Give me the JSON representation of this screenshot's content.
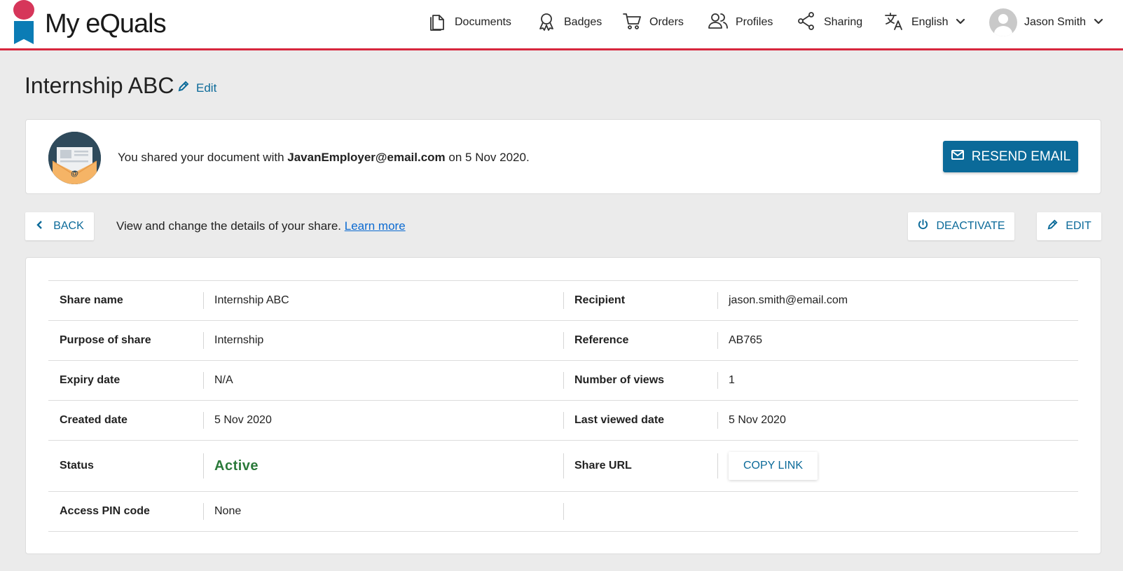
{
  "brand": {
    "name": "My eQuals"
  },
  "nav": {
    "documents": "Documents",
    "badges": "Badges",
    "orders": "Orders",
    "profiles": "Profiles",
    "sharing": "Sharing",
    "language": "English",
    "user": "Jason Smith"
  },
  "page": {
    "title": "Internship ABC",
    "edit_label": "Edit"
  },
  "notice": {
    "prefix": "You shared your document with ",
    "email": "JavanEmployer@email.com",
    "suffix": " on 5 Nov 2020.",
    "resend_label": "RESEND EMAIL"
  },
  "toolbar": {
    "back_label": "BACK",
    "description": "View and change the details of your share. ",
    "learn_more": "Learn more",
    "deactivate_label": "DEACTIVATE",
    "edit_label": "EDIT"
  },
  "details": {
    "rows": [
      {
        "left_label": "Share name",
        "left_value": "Internship ABC",
        "right_label": "Recipient",
        "right_value": "jason.smith@email.com"
      },
      {
        "left_label": "Purpose of share",
        "left_value": "Internship",
        "right_label": "Reference",
        "right_value": "AB765"
      },
      {
        "left_label": "Expiry date",
        "left_value": "N/A",
        "right_label": "Number of views",
        "right_value": "1"
      },
      {
        "left_label": "Created date",
        "left_value": "5 Nov 2020",
        "right_label": "Last viewed date",
        "right_value": "5 Nov 2020"
      },
      {
        "left_label": "Status",
        "left_value": "Active",
        "right_label": "Share URL",
        "right_value": "COPY LINK"
      },
      {
        "left_label": "Access PIN code",
        "left_value": "None",
        "right_label": "",
        "right_value": ""
      }
    ]
  },
  "colors": {
    "brand_red": "#d7263d",
    "brand_blue": "#0b6a99",
    "status_green": "#2b7a3a"
  },
  "icons": [
    "documents-icon",
    "badge-icon",
    "cart-icon",
    "people-icon",
    "share-icon",
    "translate-icon",
    "chevron-down-icon",
    "pencil-icon",
    "mail-icon",
    "chevron-left-icon",
    "power-icon"
  ]
}
